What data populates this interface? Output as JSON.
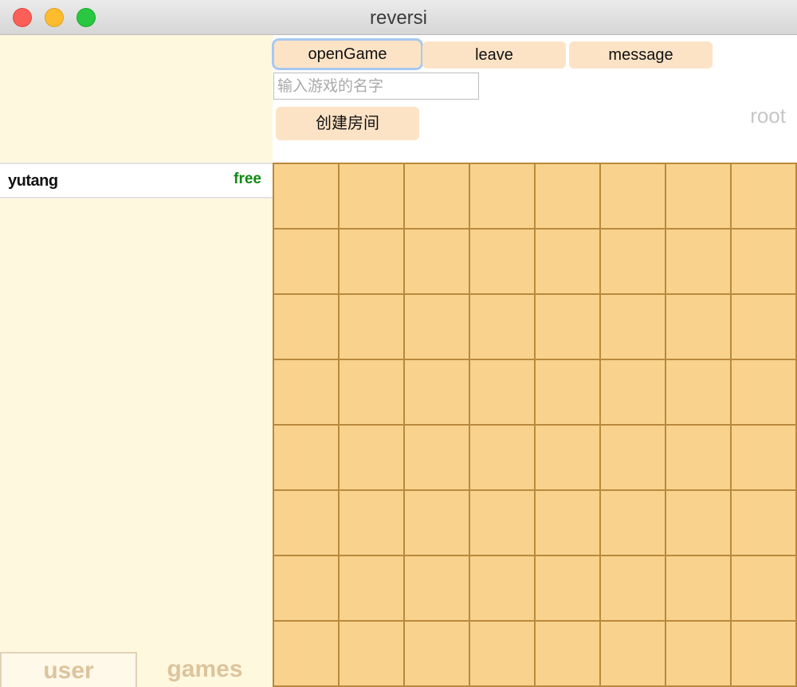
{
  "window": {
    "title": "reversi"
  },
  "toolbar": {
    "open_game": "openGame",
    "leave": "leave",
    "message": "message",
    "create_room": "创建房间",
    "game_name_placeholder": "输入游戏的名字",
    "current_user": "root"
  },
  "users": [
    {
      "name": "yutang",
      "status": "free"
    }
  ],
  "tabs": {
    "user": "user",
    "games": "games"
  },
  "board": {
    "rows": 8,
    "cols": 8
  },
  "colors": {
    "board": "#f9d38d",
    "grid": "#b9893d",
    "panel": "#fef8de",
    "button": "#fde3c6",
    "status_free": "#0e8a12"
  }
}
